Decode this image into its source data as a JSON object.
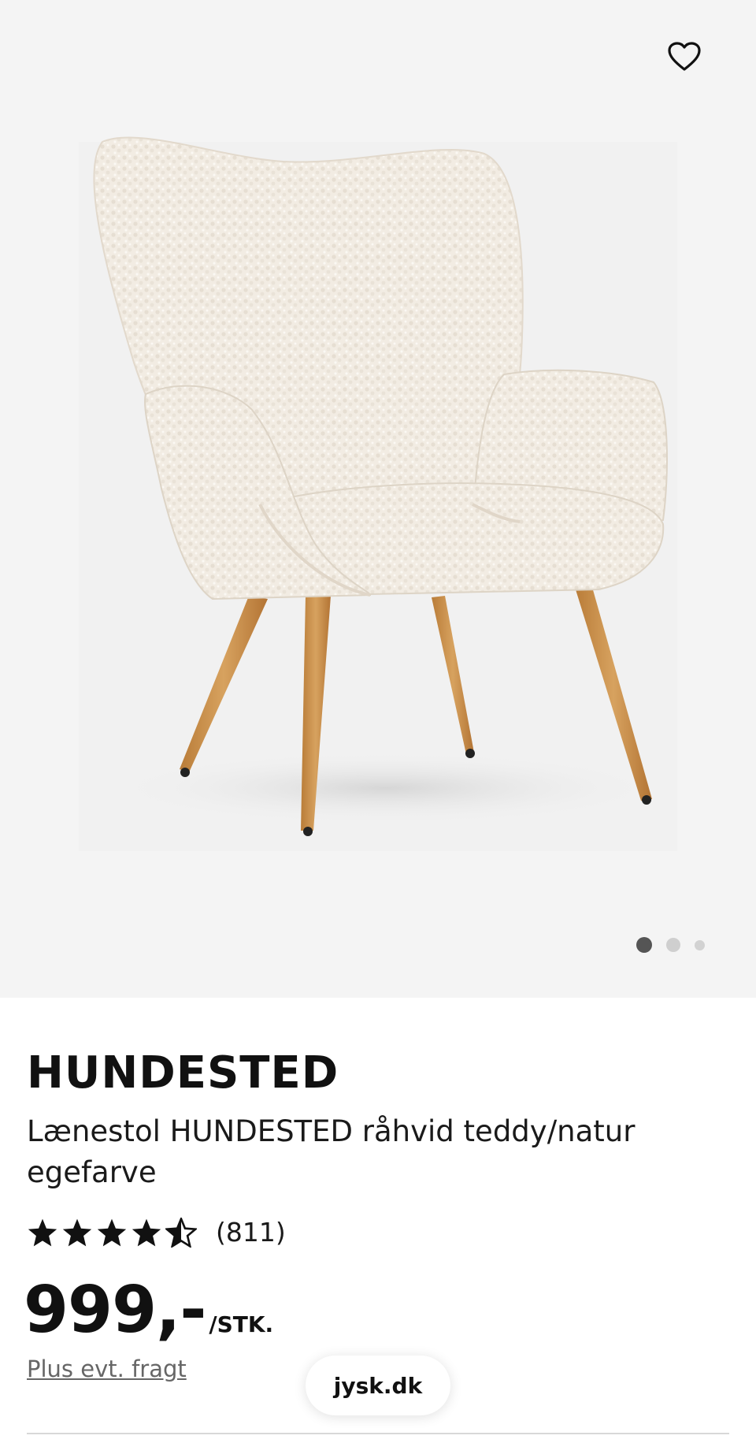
{
  "product": {
    "brand": "HUNDESTED",
    "title": "Lænestol HUNDESTED råhvid teddy/natur egefarve",
    "rating": 4.5,
    "rating_max": 5,
    "review_count": "(811)",
    "price": "999,-",
    "unit": "/STK.",
    "freight_note": "Plus evt. fragt"
  },
  "gallery": {
    "image_count": 3,
    "active_index": 0,
    "favorite_icon": "heart-outline-icon"
  },
  "site_label": "jysk.dk",
  "colors": {
    "gallery_background": "#f4f4f4",
    "fabric": "#f1ebe2",
    "wood_legs": "#c48a43",
    "text": "#111111",
    "muted_link": "#666666",
    "dot_active": "#555555",
    "dot_inactive": "#cfcfcf"
  }
}
